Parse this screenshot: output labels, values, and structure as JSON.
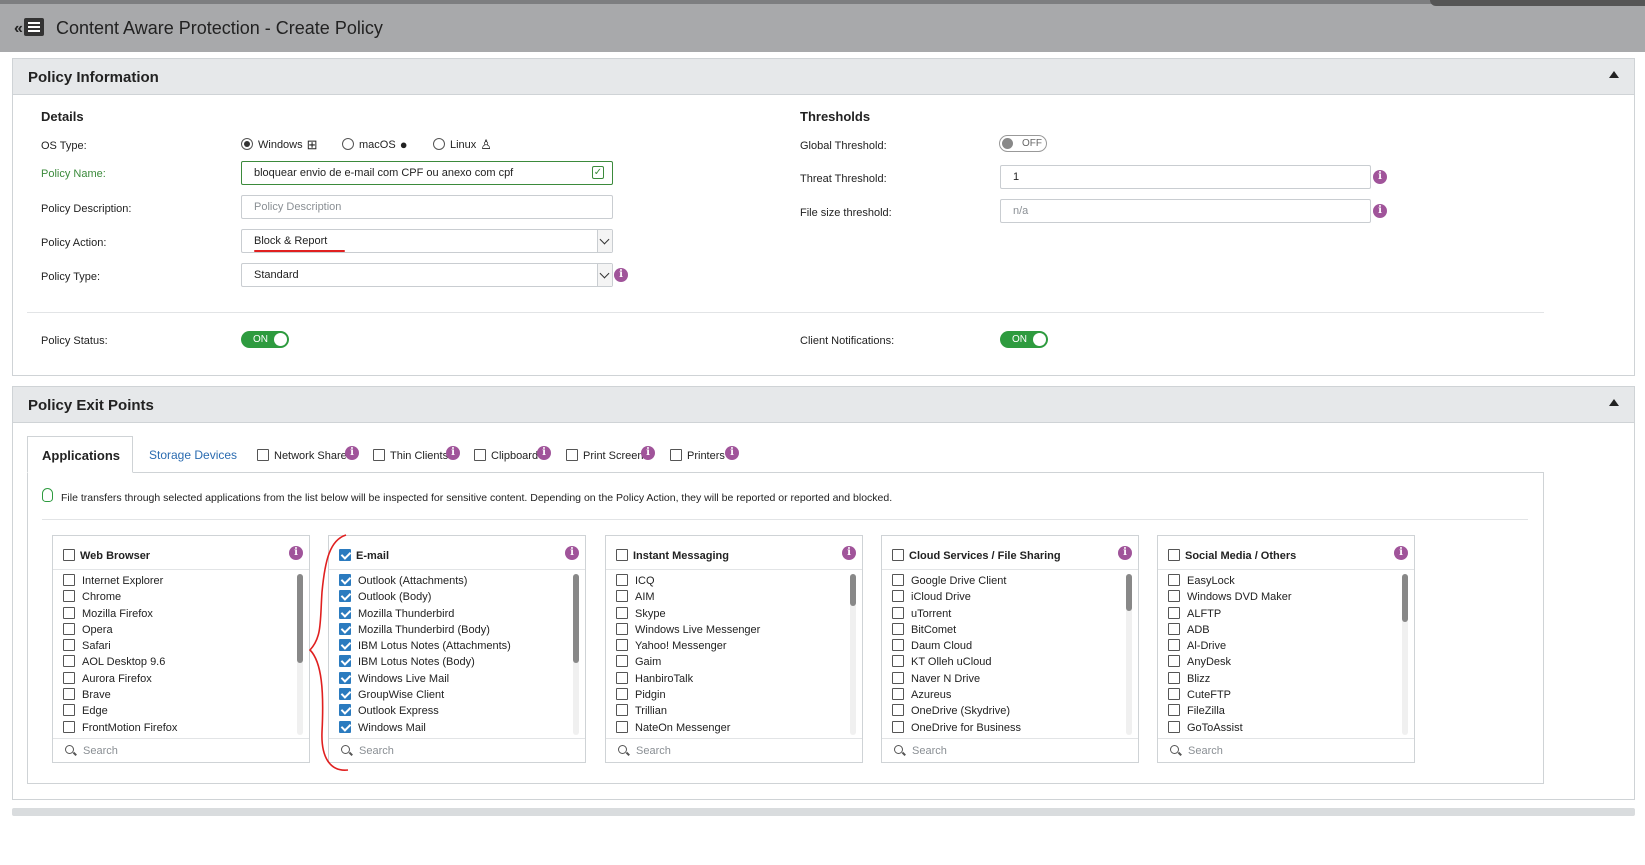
{
  "header": {
    "title": "Content Aware Protection - Create Policy",
    "back_label": "«"
  },
  "policy_info": {
    "title": "Policy Information",
    "details": {
      "title": "Details",
      "os_type_label": "OS Type:",
      "os_options": [
        {
          "label": "Windows",
          "icon": "windows-icon",
          "selected": true
        },
        {
          "label": "macOS",
          "icon": "apple-icon",
          "selected": false
        },
        {
          "label": "Linux",
          "icon": "linux-icon",
          "selected": false
        }
      ],
      "policy_name_label": "Policy Name:",
      "policy_name_value": "bloquear envio de e-mail com CPF ou anexo com cpf",
      "policy_description_label": "Policy Description:",
      "policy_description_placeholder": "Policy Description",
      "policy_action_label": "Policy Action:",
      "policy_action_value": "Block & Report",
      "policy_type_label": "Policy Type:",
      "policy_type_value": "Standard",
      "policy_status_label": "Policy Status:",
      "policy_status_value": "ON"
    },
    "thresholds": {
      "title": "Thresholds",
      "global_threshold_label": "Global Threshold:",
      "global_threshold_value": "OFF",
      "threat_threshold_label": "Threat Threshold:",
      "threat_threshold_value": "1",
      "file_size_threshold_label": "File size threshold:",
      "file_size_threshold_placeholder": "n/a",
      "client_notifications_label": "Client Notifications:",
      "client_notifications_value": "ON"
    }
  },
  "exit_points": {
    "title": "Policy Exit Points",
    "tabs": {
      "applications": "Applications",
      "storage_devices": "Storage Devices",
      "network_share": "Network Share",
      "thin_clients": "Thin Clients",
      "clipboard": "Clipboard",
      "print_screen": "Print Screen",
      "printers": "Printers"
    },
    "notice": "File transfers through selected applications from the list below will be inspected for sensitive content. Depending on the Policy Action, they will be reported or reported and blocked.",
    "search_placeholder": "Search",
    "categories": [
      {
        "name": "Web Browser",
        "checked": false,
        "scroll": [
          0,
          0.55
        ],
        "items": [
          [
            "Internet Explorer",
            false
          ],
          [
            "Chrome",
            false
          ],
          [
            "Mozilla Firefox",
            false
          ],
          [
            "Opera",
            false
          ],
          [
            "Safari",
            false
          ],
          [
            "AOL Desktop 9.6",
            false
          ],
          [
            "Aurora Firefox",
            false
          ],
          [
            "Brave",
            false
          ],
          [
            "Edge",
            false
          ],
          [
            "FrontMotion Firefox",
            false
          ]
        ]
      },
      {
        "name": "E-mail",
        "checked": true,
        "scroll": [
          0,
          0.55
        ],
        "items": [
          [
            "Outlook (Attachments)",
            true
          ],
          [
            "Outlook (Body)",
            true
          ],
          [
            "Mozilla Thunderbird",
            true
          ],
          [
            "Mozilla Thunderbird (Body)",
            true
          ],
          [
            "IBM Lotus Notes (Attachments)",
            true
          ],
          [
            "IBM Lotus Notes (Body)",
            true
          ],
          [
            "Windows Live Mail",
            true
          ],
          [
            "GroupWise Client",
            true
          ],
          [
            "Outlook Express",
            true
          ],
          [
            "Windows Mail",
            true
          ]
        ]
      },
      {
        "name": "Instant Messaging",
        "checked": false,
        "scroll": [
          0,
          0.2
        ],
        "items": [
          [
            "ICQ",
            false
          ],
          [
            "AIM",
            false
          ],
          [
            "Skype",
            false
          ],
          [
            "Windows Live Messenger",
            false
          ],
          [
            "Yahoo! Messenger",
            false
          ],
          [
            "Gaim",
            false
          ],
          [
            "HanbiroTalk",
            false
          ],
          [
            "Pidgin",
            false
          ],
          [
            "Trillian",
            false
          ],
          [
            "NateOn Messenger",
            false
          ]
        ]
      },
      {
        "name": "Cloud Services / File Sharing",
        "checked": false,
        "scroll": [
          0,
          0.23
        ],
        "items": [
          [
            "Google Drive Client",
            false
          ],
          [
            "iCloud Drive",
            false
          ],
          [
            "uTorrent",
            false
          ],
          [
            "BitComet",
            false
          ],
          [
            "Daum Cloud",
            false
          ],
          [
            "KT Olleh uCloud",
            false
          ],
          [
            "Naver N Drive",
            false
          ],
          [
            "Azureus",
            false
          ],
          [
            "OneDrive (Skydrive)",
            false
          ],
          [
            "OneDrive for Business",
            false
          ]
        ]
      },
      {
        "name": "Social Media / Others",
        "checked": false,
        "scroll": [
          0,
          0.3
        ],
        "items": [
          [
            "EasyLock",
            false
          ],
          [
            "Windows DVD Maker",
            false
          ],
          [
            "ALFTP",
            false
          ],
          [
            "ADB",
            false
          ],
          [
            "Al-Drive",
            false
          ],
          [
            "AnyDesk",
            false
          ],
          [
            "Blizz",
            false
          ],
          [
            "CuteFTP",
            false
          ],
          [
            "FileZilla",
            false
          ],
          [
            "GoToAssist",
            false
          ]
        ]
      }
    ]
  }
}
